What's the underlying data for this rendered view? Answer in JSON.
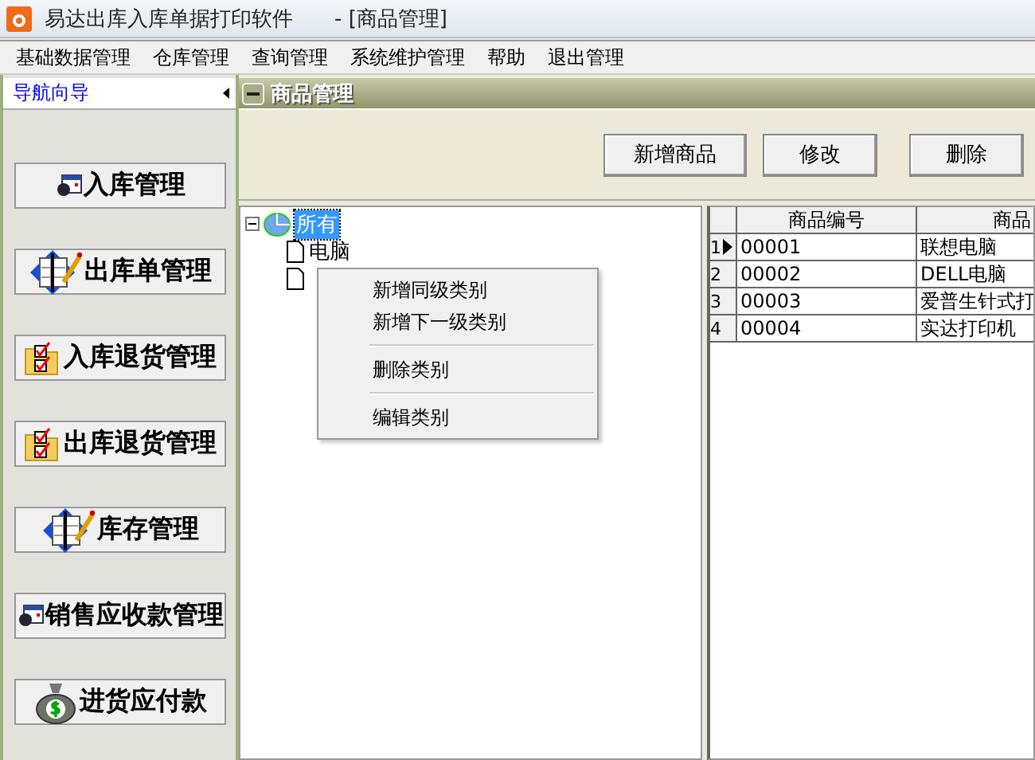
{
  "window": {
    "title": "易达出库入库单据打印软件",
    "document": "- [商品管理]"
  },
  "menu": [
    "基础数据管理",
    "仓库管理",
    "查询管理",
    "系统维护管理",
    "帮助",
    "退出管理"
  ],
  "sidebar": {
    "title": "导航向导",
    "items": [
      {
        "label": "入库管理",
        "kind": "window"
      },
      {
        "label": "出库单管理",
        "kind": "diamond"
      },
      {
        "label": "入库退货管理",
        "kind": "folder"
      },
      {
        "label": "出库退货管理",
        "kind": "folder"
      },
      {
        "label": "库存管理",
        "kind": "diamond"
      },
      {
        "label": "销售应收款管理",
        "kind": "window"
      },
      {
        "label": "进货应付款",
        "kind": "bag"
      }
    ]
  },
  "panel": {
    "title": "商品管理",
    "buttons": [
      "新增商品",
      "修改",
      "删除"
    ]
  },
  "tree": {
    "label": "所有",
    "selected": true,
    "expanded": true,
    "children": [
      {
        "label": "电脑",
        "kind": "document"
      },
      {
        "kind": "document"
      }
    ]
  },
  "context_menu": {
    "groups": [
      [
        "新增同级类别",
        "新增下一级类别"
      ],
      [
        "删除类别"
      ],
      [
        "编辑类别"
      ]
    ]
  },
  "table": {
    "columns": [
      "商品编号",
      "商品"
    ],
    "rows": [
      {
        "index": "1",
        "selected": true,
        "cells": [
          "00001",
          "联想电脑"
        ]
      },
      {
        "index": "2",
        "selected": false,
        "cells": [
          "00002",
          "DELL电脑"
        ]
      },
      {
        "index": "3",
        "selected": false,
        "cells": [
          "00003",
          "爱普生针式打"
        ]
      },
      {
        "index": "4",
        "selected": false,
        "cells": [
          "00004",
          "实达打印机"
        ]
      }
    ]
  }
}
